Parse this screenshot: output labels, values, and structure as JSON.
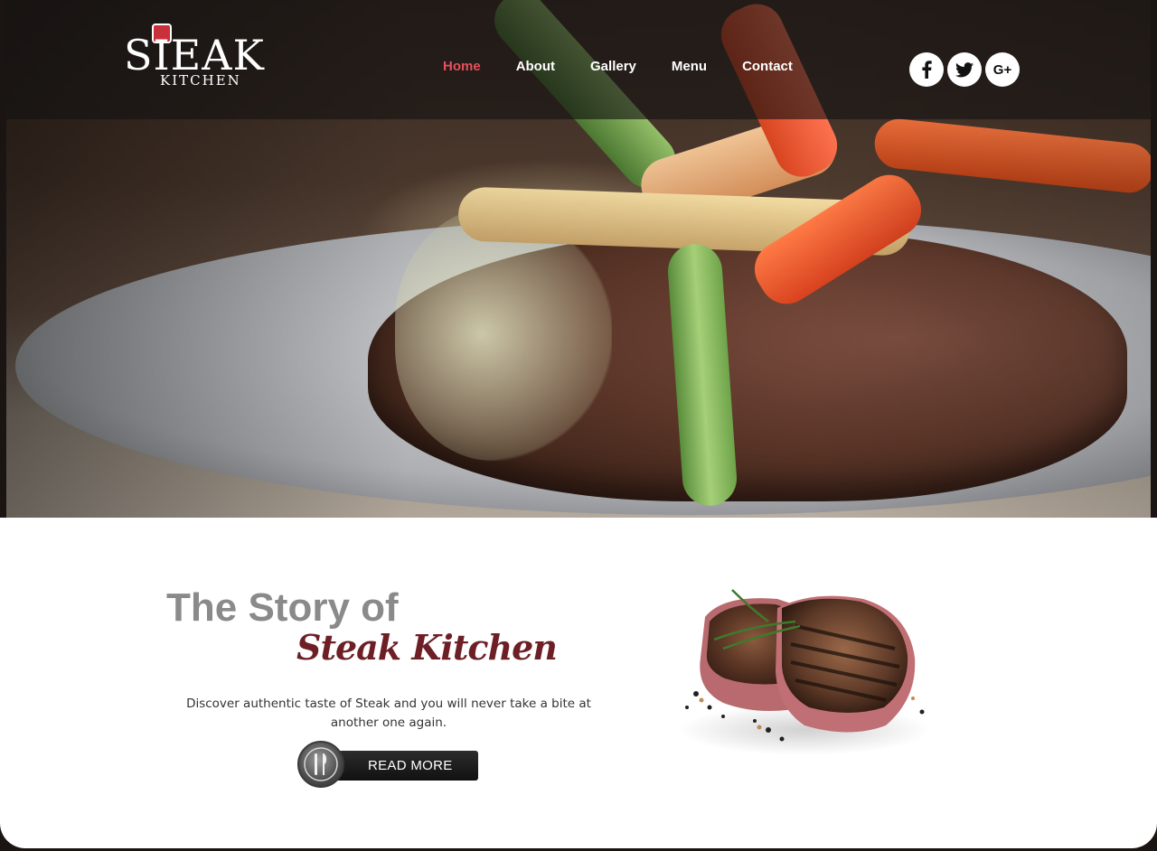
{
  "brand": {
    "name_main": "SIEAK",
    "name_sub": "KITCHEN"
  },
  "nav": {
    "items": [
      {
        "label": "Home",
        "active": true
      },
      {
        "label": "About",
        "active": false
      },
      {
        "label": "Gallery",
        "active": false
      },
      {
        "label": "Menu",
        "active": false
      },
      {
        "label": "Contact",
        "active": false
      }
    ]
  },
  "social": {
    "facebook_icon": "facebook-icon",
    "twitter_icon": "twitter-icon",
    "googleplus_label": "G+"
  },
  "story": {
    "title": "The Story of",
    "script_title": "Steak Kitchen",
    "description": "Discover authentic taste of Steak and you will never take a bite at another one again.",
    "button_label": "READ MORE",
    "button_icon": "fork-knife-icon"
  },
  "colors": {
    "accent": "#e5505b",
    "script": "#6e1f26",
    "title_gray": "#8a8a8a"
  }
}
